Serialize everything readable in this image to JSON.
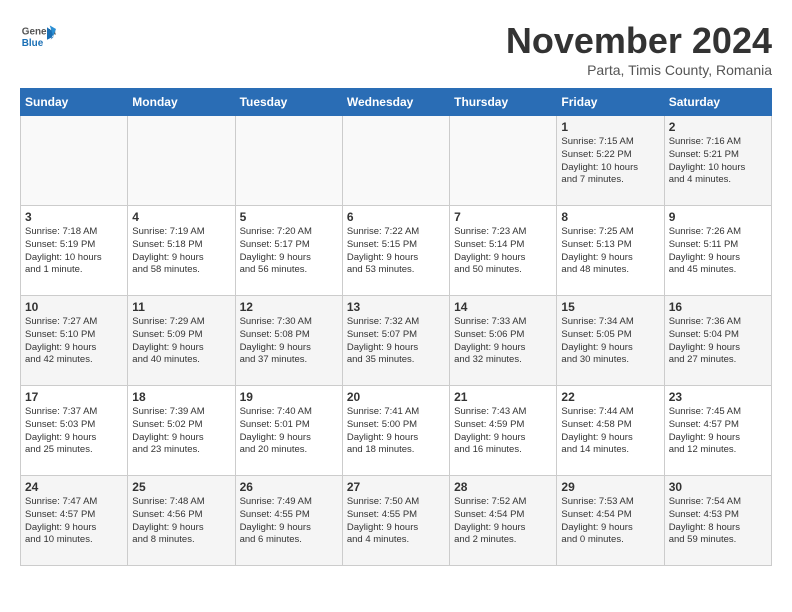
{
  "header": {
    "logo_line1": "General",
    "logo_line2": "Blue",
    "title": "November 2024",
    "subtitle": "Parta, Timis County, Romania"
  },
  "weekdays": [
    "Sunday",
    "Monday",
    "Tuesday",
    "Wednesday",
    "Thursday",
    "Friday",
    "Saturday"
  ],
  "weeks": [
    [
      {
        "day": "",
        "info": ""
      },
      {
        "day": "",
        "info": ""
      },
      {
        "day": "",
        "info": ""
      },
      {
        "day": "",
        "info": ""
      },
      {
        "day": "",
        "info": ""
      },
      {
        "day": "1",
        "info": "Sunrise: 7:15 AM\nSunset: 5:22 PM\nDaylight: 10 hours\nand 7 minutes."
      },
      {
        "day": "2",
        "info": "Sunrise: 7:16 AM\nSunset: 5:21 PM\nDaylight: 10 hours\nand 4 minutes."
      }
    ],
    [
      {
        "day": "3",
        "info": "Sunrise: 7:18 AM\nSunset: 5:19 PM\nDaylight: 10 hours\nand 1 minute."
      },
      {
        "day": "4",
        "info": "Sunrise: 7:19 AM\nSunset: 5:18 PM\nDaylight: 9 hours\nand 58 minutes."
      },
      {
        "day": "5",
        "info": "Sunrise: 7:20 AM\nSunset: 5:17 PM\nDaylight: 9 hours\nand 56 minutes."
      },
      {
        "day": "6",
        "info": "Sunrise: 7:22 AM\nSunset: 5:15 PM\nDaylight: 9 hours\nand 53 minutes."
      },
      {
        "day": "7",
        "info": "Sunrise: 7:23 AM\nSunset: 5:14 PM\nDaylight: 9 hours\nand 50 minutes."
      },
      {
        "day": "8",
        "info": "Sunrise: 7:25 AM\nSunset: 5:13 PM\nDaylight: 9 hours\nand 48 minutes."
      },
      {
        "day": "9",
        "info": "Sunrise: 7:26 AM\nSunset: 5:11 PM\nDaylight: 9 hours\nand 45 minutes."
      }
    ],
    [
      {
        "day": "10",
        "info": "Sunrise: 7:27 AM\nSunset: 5:10 PM\nDaylight: 9 hours\nand 42 minutes."
      },
      {
        "day": "11",
        "info": "Sunrise: 7:29 AM\nSunset: 5:09 PM\nDaylight: 9 hours\nand 40 minutes."
      },
      {
        "day": "12",
        "info": "Sunrise: 7:30 AM\nSunset: 5:08 PM\nDaylight: 9 hours\nand 37 minutes."
      },
      {
        "day": "13",
        "info": "Sunrise: 7:32 AM\nSunset: 5:07 PM\nDaylight: 9 hours\nand 35 minutes."
      },
      {
        "day": "14",
        "info": "Sunrise: 7:33 AM\nSunset: 5:06 PM\nDaylight: 9 hours\nand 32 minutes."
      },
      {
        "day": "15",
        "info": "Sunrise: 7:34 AM\nSunset: 5:05 PM\nDaylight: 9 hours\nand 30 minutes."
      },
      {
        "day": "16",
        "info": "Sunrise: 7:36 AM\nSunset: 5:04 PM\nDaylight: 9 hours\nand 27 minutes."
      }
    ],
    [
      {
        "day": "17",
        "info": "Sunrise: 7:37 AM\nSunset: 5:03 PM\nDaylight: 9 hours\nand 25 minutes."
      },
      {
        "day": "18",
        "info": "Sunrise: 7:39 AM\nSunset: 5:02 PM\nDaylight: 9 hours\nand 23 minutes."
      },
      {
        "day": "19",
        "info": "Sunrise: 7:40 AM\nSunset: 5:01 PM\nDaylight: 9 hours\nand 20 minutes."
      },
      {
        "day": "20",
        "info": "Sunrise: 7:41 AM\nSunset: 5:00 PM\nDaylight: 9 hours\nand 18 minutes."
      },
      {
        "day": "21",
        "info": "Sunrise: 7:43 AM\nSunset: 4:59 PM\nDaylight: 9 hours\nand 16 minutes."
      },
      {
        "day": "22",
        "info": "Sunrise: 7:44 AM\nSunset: 4:58 PM\nDaylight: 9 hours\nand 14 minutes."
      },
      {
        "day": "23",
        "info": "Sunrise: 7:45 AM\nSunset: 4:57 PM\nDaylight: 9 hours\nand 12 minutes."
      }
    ],
    [
      {
        "day": "24",
        "info": "Sunrise: 7:47 AM\nSunset: 4:57 PM\nDaylight: 9 hours\nand 10 minutes."
      },
      {
        "day": "25",
        "info": "Sunrise: 7:48 AM\nSunset: 4:56 PM\nDaylight: 9 hours\nand 8 minutes."
      },
      {
        "day": "26",
        "info": "Sunrise: 7:49 AM\nSunset: 4:55 PM\nDaylight: 9 hours\nand 6 minutes."
      },
      {
        "day": "27",
        "info": "Sunrise: 7:50 AM\nSunset: 4:55 PM\nDaylight: 9 hours\nand 4 minutes."
      },
      {
        "day": "28",
        "info": "Sunrise: 7:52 AM\nSunset: 4:54 PM\nDaylight: 9 hours\nand 2 minutes."
      },
      {
        "day": "29",
        "info": "Sunrise: 7:53 AM\nSunset: 4:54 PM\nDaylight: 9 hours\nand 0 minutes."
      },
      {
        "day": "30",
        "info": "Sunrise: 7:54 AM\nSunset: 4:53 PM\nDaylight: 8 hours\nand 59 minutes."
      }
    ]
  ]
}
